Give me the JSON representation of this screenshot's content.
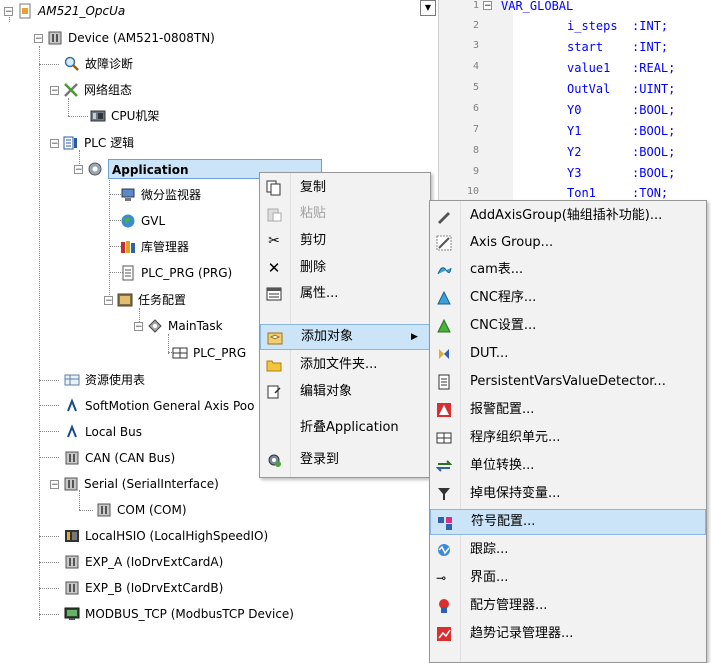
{
  "tree": {
    "project": "AM521_OpcUa",
    "device": "Device (AM521-0808TN)",
    "diagnostics": "故障诊断",
    "network_config": "网络组态",
    "cpu_rack": "CPU机架",
    "plc_logic": "PLC 逻辑",
    "application": "Application",
    "diff_monitor": "微分监视器",
    "gvl": "GVL",
    "library_manager": "库管理器",
    "plc_prg": "PLC_PRG (PRG)",
    "task_config": "任务配置",
    "main_task": "MainTask",
    "plc_prg_call": "PLC_PRG",
    "resource_usage": "资源使用表",
    "softmotion_pool": "SoftMotion General Axis Poo",
    "local_bus": "Local Bus",
    "can": "CAN (CAN Bus)",
    "serial": "Serial (SerialInterface)",
    "com": "COM (COM)",
    "localhsio": "LocalHSIO (LocalHighSpeedIO)",
    "exp_a": "EXP_A (IoDrvExtCardA)",
    "exp_b": "EXP_B (IoDrvExtCardB)",
    "modbus": "MODBUS_TCP (ModbusTCP Device)"
  },
  "editor": {
    "lines": [
      {
        "num": "1",
        "text": "VAR_GLOBAL"
      },
      {
        "num": "2",
        "text": "i_steps  :INT;"
      },
      {
        "num": "3",
        "text": "start    :INT;"
      },
      {
        "num": "4",
        "text": "value1   :REAL;"
      },
      {
        "num": "5",
        "text": "OutVal   :UINT;"
      },
      {
        "num": "6",
        "text": "Y0       :BOOL;"
      },
      {
        "num": "7",
        "text": "Y1       :BOOL;"
      },
      {
        "num": "8",
        "text": "Y2       :BOOL;"
      },
      {
        "num": "9",
        "text": "Y3       :BOOL;"
      },
      {
        "num": "10",
        "text": "Ton1     :TON;"
      }
    ]
  },
  "context_menu": {
    "items": [
      "复制",
      "粘贴",
      "剪切",
      "删除",
      "属性...",
      "添加对象",
      "添加文件夹...",
      "编辑对象",
      "折叠Application",
      "登录到"
    ]
  },
  "submenu": {
    "items": [
      "AddAxisGroup(轴组插补功能)...",
      "Axis Group...",
      "cam表...",
      "CNC程序...",
      "CNC设置...",
      "DUT...",
      "PersistentVarsValueDetector...",
      "报警配置...",
      "程序组织单元...",
      "单位转换...",
      "掉电保持变量...",
      "符号配置...",
      "跟踪...",
      "界面...",
      "配方管理器...",
      "趋势记录管理器..."
    ]
  }
}
